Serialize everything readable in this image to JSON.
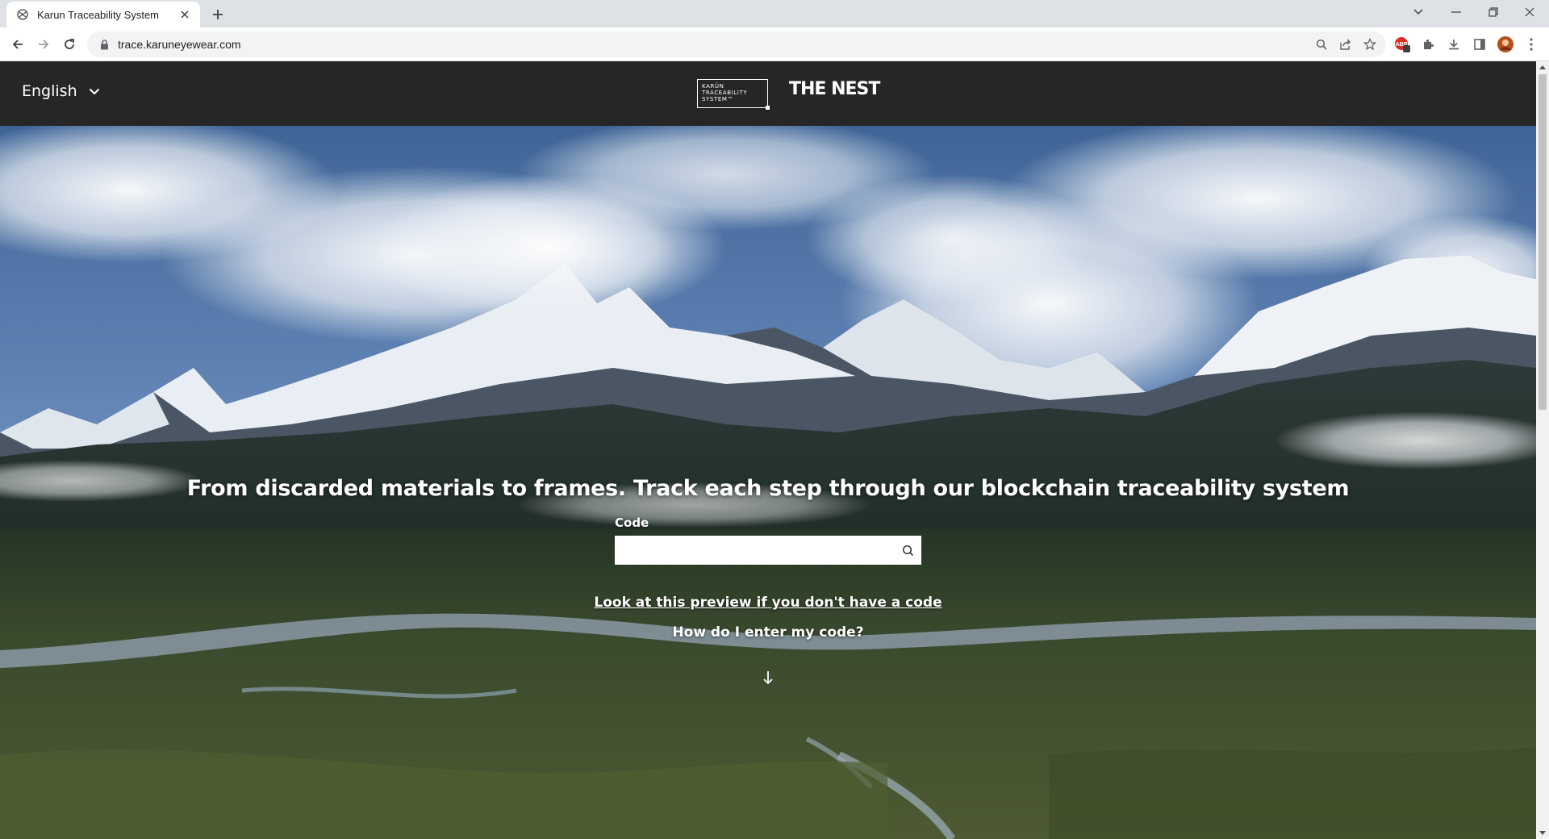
{
  "browser": {
    "tab_title": "Karun Traceability System",
    "url": "trace.karuneyewear.com",
    "extension_badge": "2"
  },
  "header": {
    "language": "English",
    "logo_karun_lines": [
      "KARÜN",
      "TRACEABILITY",
      "SYSTEM™"
    ],
    "logo_nest": "THE NEST"
  },
  "hero": {
    "headline": "From discarded materials to frames. Track each step through our blockchain traceability system",
    "code_label": "Code",
    "code_value": "",
    "preview_link": "Look at this preview if you don't have a code",
    "howto": "How do I enter my code?"
  },
  "colors": {
    "header_bg": "#262626",
    "sky_top": "#4a6f9e",
    "snow": "#e9eef4",
    "valley": "#3b4a2e"
  }
}
